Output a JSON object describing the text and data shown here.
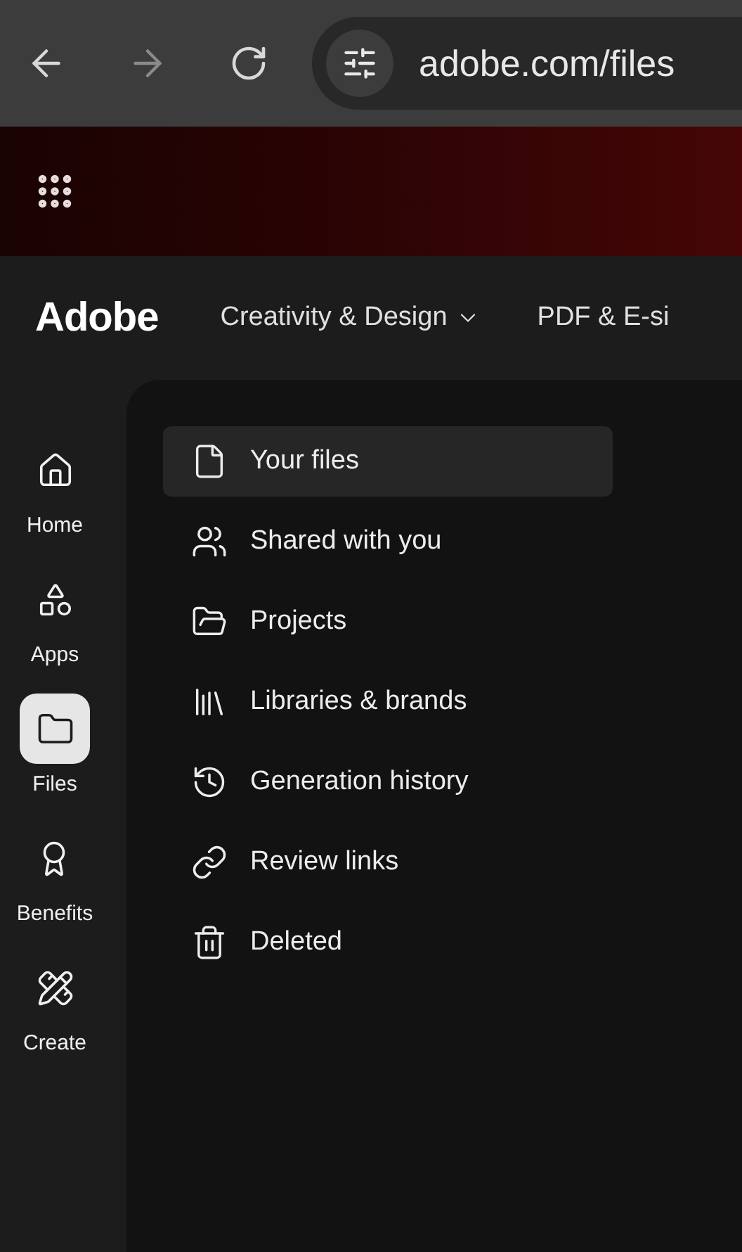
{
  "browser": {
    "url": "adobe.com/files"
  },
  "header": {
    "brand": "Adobe",
    "nav": [
      {
        "label": "Creativity & Design",
        "has_menu": true
      },
      {
        "label": "PDF & E-si",
        "has_menu": false
      }
    ]
  },
  "rail": [
    {
      "label": "Home",
      "selected": false
    },
    {
      "label": "Apps",
      "selected": false
    },
    {
      "label": "Files",
      "selected": true
    },
    {
      "label": "Benefits",
      "selected": false
    },
    {
      "label": "Create",
      "selected": false
    }
  ],
  "files_nav": [
    {
      "label": "Your files",
      "selected": true
    },
    {
      "label": "Shared with you",
      "selected": false
    },
    {
      "label": "Projects",
      "selected": false
    },
    {
      "label": "Libraries & brands",
      "selected": false
    },
    {
      "label": "Generation history",
      "selected": false
    },
    {
      "label": "Review links",
      "selected": false
    },
    {
      "label": "Deleted",
      "selected": false
    }
  ]
}
